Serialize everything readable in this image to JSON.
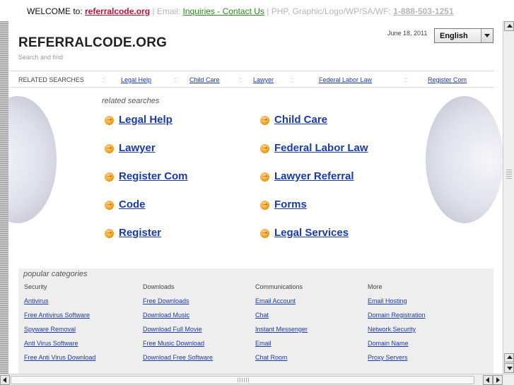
{
  "topbar": {
    "welcome": "WELCOME to: ",
    "site": "referralcode.org",
    "sep1": " | ",
    "email_label": "Email: ",
    "email_link": "Inquiries - Contact Us",
    "sep2": " | ",
    "services": "PHP, Graphic/Logo/WP/SA/WF: ",
    "phone": "1-888-503-1251"
  },
  "header": {
    "title": "REFERRALCODE.ORG",
    "subtitle": "Search and find",
    "date": "June 18, 2011",
    "language": "English"
  },
  "related_bar": {
    "heading": "RELATED SEARCHES",
    "separator": "::",
    "links": [
      "Legal Help",
      "Child Care",
      "Lawyer",
      "Federal Labor Law",
      "Register Com"
    ]
  },
  "related": {
    "label": "related searches",
    "left": [
      "Legal Help",
      "Lawyer",
      "Register Com",
      "Code",
      "Register"
    ],
    "right": [
      "Child Care",
      "Federal Labor Law",
      "Lawyer Referral",
      "Forms",
      "Legal Services"
    ]
  },
  "popular": {
    "label": "popular categories",
    "columns": [
      {
        "heading": "Security",
        "items": [
          "Antivirus",
          "Free Antivirus Software",
          "Spyware Removal",
          "Anti Virus Software",
          "Free Anti Virus Download"
        ]
      },
      {
        "heading": "Downloads",
        "items": [
          "Free Downloads",
          "Download Music",
          "Download Full Movie",
          "Free Music Download",
          "Download Free Software"
        ]
      },
      {
        "heading": "Communications",
        "items": [
          "Email Account",
          "Chat",
          "Instant Messenger",
          "Email",
          "Chat Room"
        ]
      },
      {
        "heading": "More",
        "items": [
          "Email Hosting",
          "Domain Registration",
          "Network Security",
          "Domain Name",
          "Proxy Servers"
        ]
      }
    ]
  },
  "colors": {
    "link": "#1a3aa8",
    "site_red": "#c8102e",
    "email_green": "#2a8a1c",
    "popular_bg": "#eeeeee"
  },
  "icons": {
    "bullet": "orange-arrow-circle-icon",
    "select": "chevron-down-icon"
  }
}
